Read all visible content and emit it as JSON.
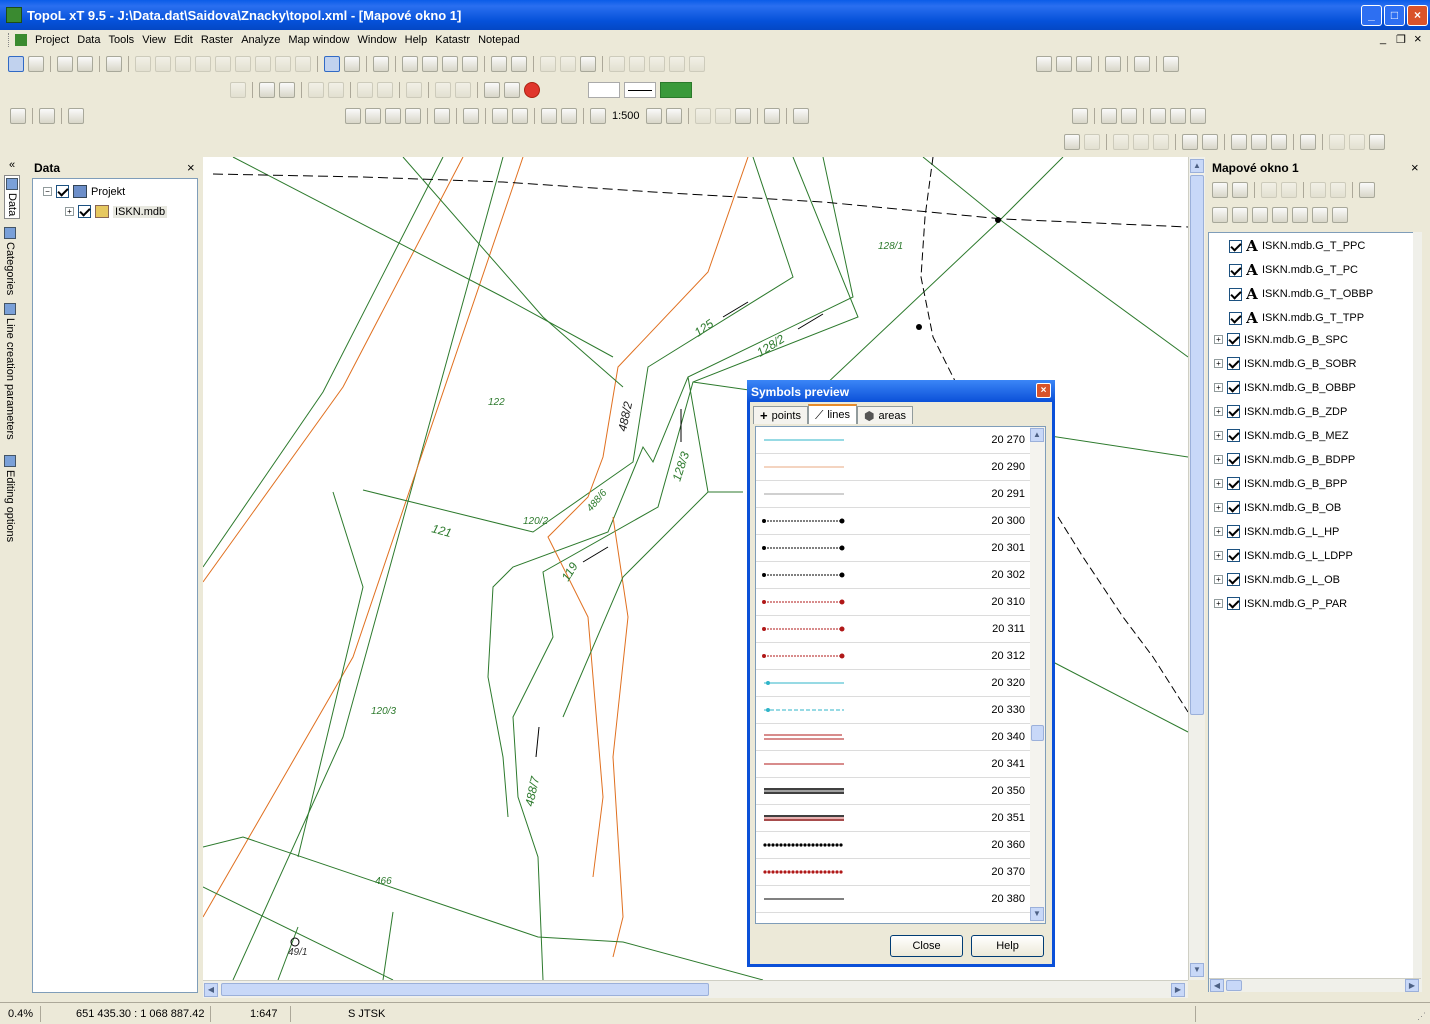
{
  "window": {
    "title": "TopoL xT 9.5 - J:\\Data.dat\\Saidova\\Znacky\\topol.xml - [Mapové okno 1]",
    "min": "_",
    "max": "□",
    "close": "×"
  },
  "menu": {
    "items": [
      "Project",
      "Data",
      "Tools",
      "View",
      "Edit",
      "Raster",
      "Analyze",
      "Map window",
      "Window",
      "Help",
      "Katastr",
      "Notepad"
    ],
    "mdi_min": "_",
    "mdi_restore": "❐",
    "mdi_close": "×"
  },
  "toolbar": {
    "scale": "1:500"
  },
  "left_tabs": [
    "Data",
    "Categories",
    "Line creation parameters",
    "Editing options"
  ],
  "data_panel": {
    "title": "Data",
    "close": "×",
    "tree": [
      {
        "label": "Projekt",
        "expander": "−"
      },
      {
        "label": "ISKN.mdb",
        "expander": "+"
      }
    ]
  },
  "map": {
    "parcels": [
      "128/1",
      "125",
      "128/2",
      "122",
      "488/2",
      "128/3",
      "121",
      "120/2",
      "488/6",
      "119",
      "120/3",
      "488/7",
      "466",
      "49/1"
    ],
    "colors": {
      "parcel": "#2d7a2d",
      "road": "#e07020",
      "boundary": "#000000",
      "label": "#2d7a2d"
    }
  },
  "layers_panel": {
    "title": "Mapové okno 1",
    "close": "×",
    "layers": [
      {
        "name": "ISKN.mdb.G_T_PPC",
        "type": "text"
      },
      {
        "name": "ISKN.mdb.G_T_PC",
        "type": "text"
      },
      {
        "name": "ISKN.mdb.G_T_OBBP",
        "type": "text"
      },
      {
        "name": "ISKN.mdb.G_T_TPP",
        "type": "text"
      },
      {
        "name": "ISKN.mdb.G_B_SPC",
        "type": "group"
      },
      {
        "name": "ISKN.mdb.G_B_SOBR",
        "type": "group"
      },
      {
        "name": "ISKN.mdb.G_B_OBBP",
        "type": "group"
      },
      {
        "name": "ISKN.mdb.G_B_ZDP",
        "type": "group"
      },
      {
        "name": "ISKN.mdb.G_B_MEZ",
        "type": "group"
      },
      {
        "name": "ISKN.mdb.G_B_BDPP",
        "type": "group"
      },
      {
        "name": "ISKN.mdb.G_B_BPP",
        "type": "group"
      },
      {
        "name": "ISKN.mdb.G_B_OB",
        "type": "group"
      },
      {
        "name": "ISKN.mdb.G_L_HP",
        "type": "group"
      },
      {
        "name": "ISKN.mdb.G_L_LDPP",
        "type": "group"
      },
      {
        "name": "ISKN.mdb.G_L_OB",
        "type": "group"
      },
      {
        "name": "ISKN.mdb.G_P_PAR",
        "type": "group"
      }
    ]
  },
  "dialog": {
    "title": "Symbols preview",
    "close": "×",
    "tabs": [
      {
        "label": "points",
        "icon": "cross-icon"
      },
      {
        "label": "lines",
        "icon": "line-icon",
        "active": true
      },
      {
        "label": "areas",
        "icon": "polygon-icon"
      }
    ],
    "symbols": [
      {
        "code": "20 270",
        "style": "solid",
        "color": "#2fb4c8"
      },
      {
        "code": "20 290",
        "style": "solid",
        "color": "#e8a880"
      },
      {
        "code": "20 291",
        "style": "solid",
        "color": "#a0a0a0"
      },
      {
        "code": "20 300",
        "style": "dotted-ends",
        "color": "#000000"
      },
      {
        "code": "20 301",
        "style": "dotted-ends",
        "color": "#000000"
      },
      {
        "code": "20 302",
        "style": "dotted-ends",
        "color": "#000000"
      },
      {
        "code": "20 310",
        "style": "dotted-ends",
        "color": "#b01818"
      },
      {
        "code": "20 311",
        "style": "dotted-ends",
        "color": "#b01818"
      },
      {
        "code": "20 312",
        "style": "dotted-ends",
        "color": "#b01818"
      },
      {
        "code": "20 320",
        "style": "dot-start",
        "color": "#2fb4c8"
      },
      {
        "code": "20 330",
        "style": "dashed-start",
        "color": "#2fb4c8"
      },
      {
        "code": "20 340",
        "style": "zigzag",
        "color": "#b01818"
      },
      {
        "code": "20 341",
        "style": "solid",
        "color": "#b01818"
      },
      {
        "code": "20 350",
        "style": "double",
        "color": "#000000"
      },
      {
        "code": "20 351",
        "style": "double",
        "color": "#8a1010"
      },
      {
        "code": "20 360",
        "style": "beads",
        "color": "#000000"
      },
      {
        "code": "20 370",
        "style": "beads",
        "color": "#b01818"
      },
      {
        "code": "20 380",
        "style": "solid",
        "color": "#000000"
      }
    ],
    "close_button": "Close",
    "help_button": "Help"
  },
  "status": {
    "zoom": "0.4%",
    "coords": "651 435.30 : 1 068 887.42",
    "scale": "1:647",
    "crs": "S JTSK"
  }
}
